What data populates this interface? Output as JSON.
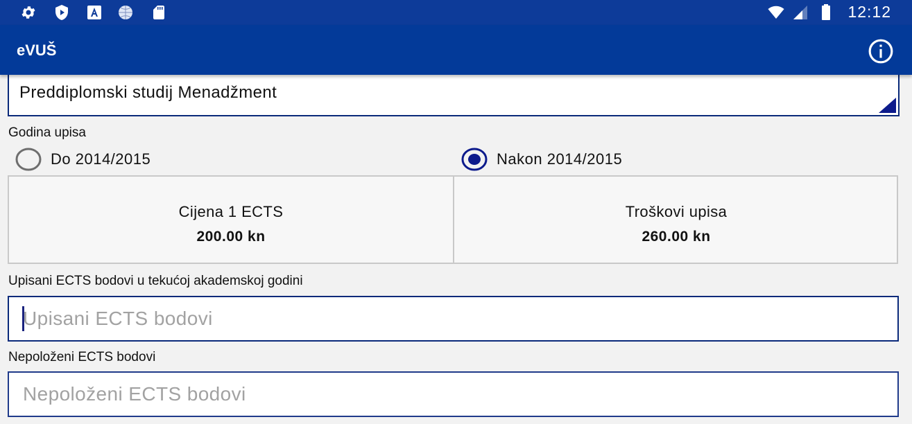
{
  "statusbar": {
    "clock": "12:12",
    "icons": [
      "gear-icon",
      "play-protect-icon",
      "font-a-icon",
      "globe-icon",
      "sd-card-icon",
      "wifi-icon",
      "signal-icon",
      "battery-icon"
    ]
  },
  "appbar": {
    "title": "eVUŠ",
    "info_icon": "info-icon"
  },
  "program_select": {
    "value": "Preddiplomski studij Menadžment"
  },
  "enrollment_year": {
    "label": "Godina upisa",
    "options": [
      {
        "label": "Do 2014/2015",
        "selected": false
      },
      {
        "label": "Nakon 2014/2015",
        "selected": true
      }
    ]
  },
  "costs": {
    "ects_price_label": "Cijena 1 ECTS",
    "ects_price_value": "200.00 kn",
    "enrollment_cost_label": "Troškovi upisa",
    "enrollment_cost_value": "260.00 kn"
  },
  "enrolled_ects": {
    "label": "Upisani ECTS bodovi u tekućoj akademskoj godini",
    "placeholder": "Upisani ECTS bodovi",
    "value": ""
  },
  "failed_ects": {
    "label": "Nepoloženi ECTS bodovi",
    "placeholder": "Nepoloženi ECTS bodovi",
    "value": ""
  },
  "colors": {
    "primary": "#033a99",
    "accent": "#0d1b8c"
  }
}
